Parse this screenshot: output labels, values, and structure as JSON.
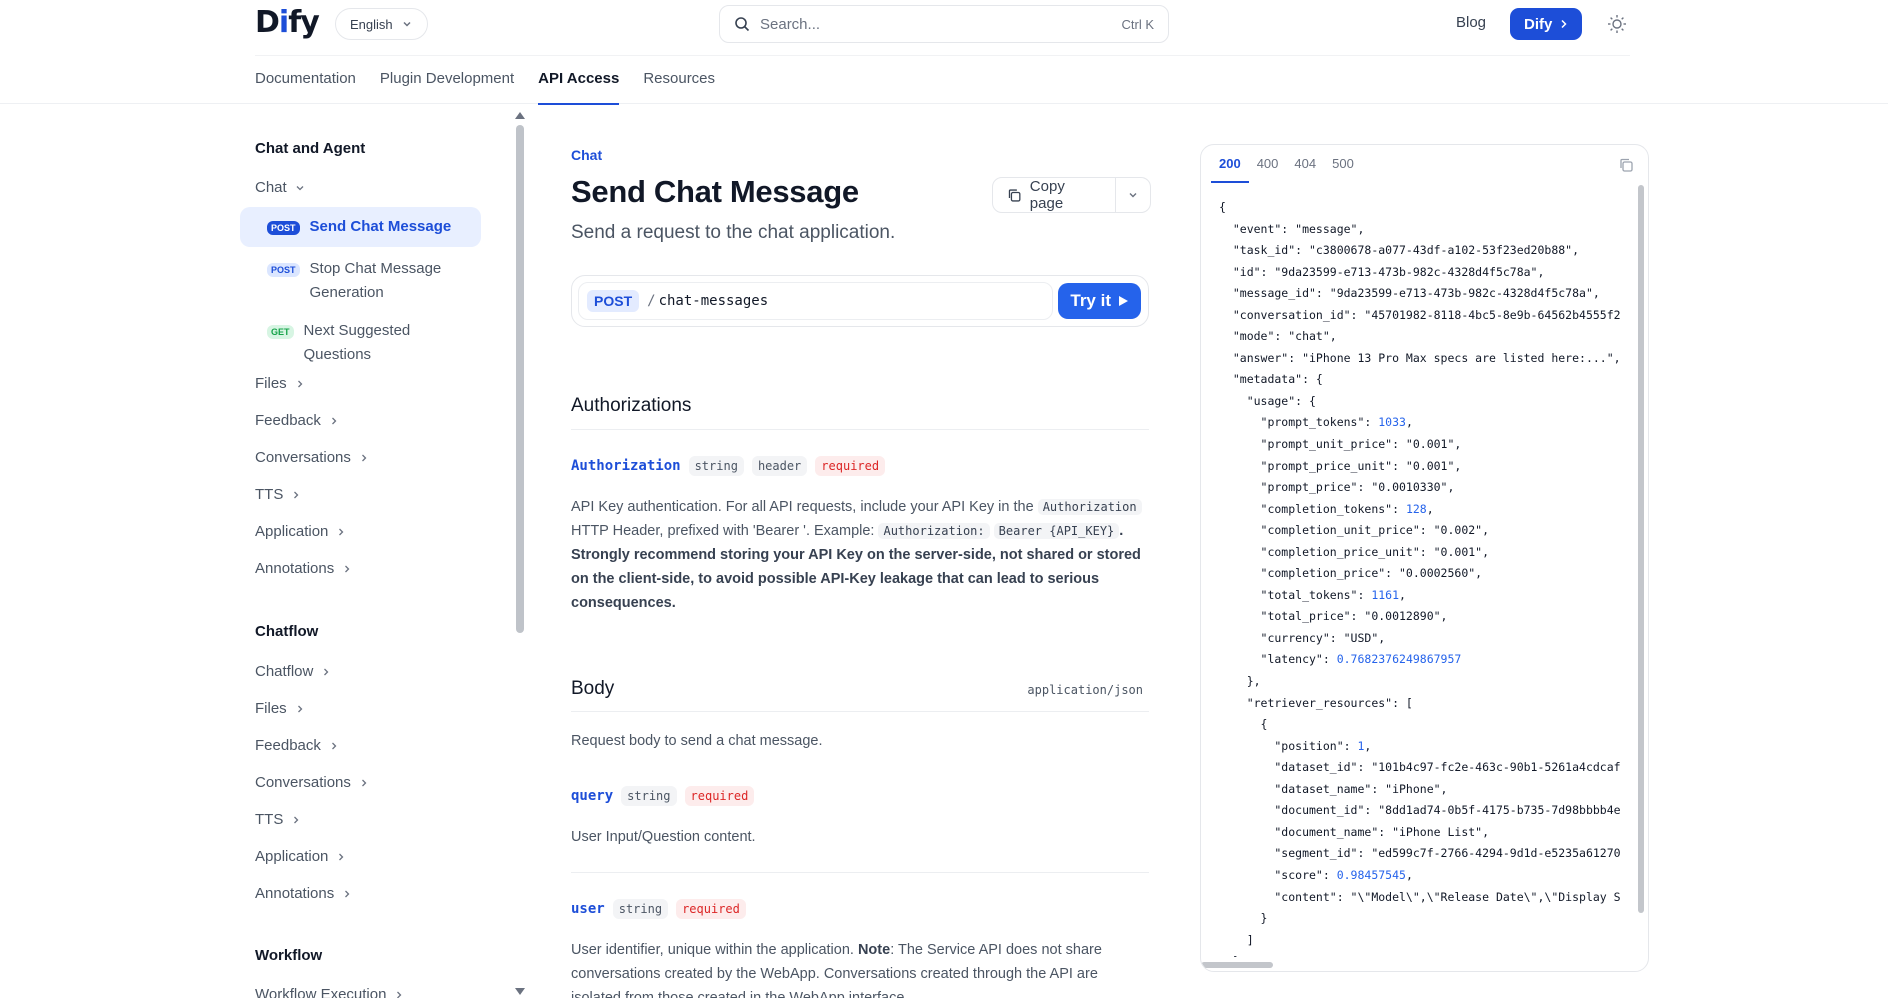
{
  "header": {
    "logo": "Dify",
    "language": "English",
    "search_placeholder": "Search...",
    "search_shortcut": "Ctrl K",
    "blog": "Blog",
    "cta": "Dify"
  },
  "nav_tabs": [
    "Documentation",
    "Plugin Development",
    "API Access",
    "Resources"
  ],
  "sidebar": {
    "section_chat_agent": "Chat and Agent",
    "chat_group": "Chat",
    "chat_items": [
      {
        "method": "POST",
        "label": "Send Chat Message"
      },
      {
        "method": "POST",
        "label": "Stop Chat Message Generation"
      },
      {
        "method": "GET",
        "label": "Next Suggested Questions"
      }
    ],
    "chat_agent_groups": [
      "Files",
      "Feedback",
      "Conversations",
      "TTS",
      "Application",
      "Annotations"
    ],
    "section_chatflow": "Chatflow",
    "chatflow_groups": [
      "Chatflow",
      "Files",
      "Feedback",
      "Conversations",
      "TTS",
      "Application",
      "Annotations"
    ],
    "section_workflow": "Workflow",
    "workflow_groups": [
      "Workflow Execution"
    ]
  },
  "main": {
    "breadcrumb": "Chat",
    "title": "Send Chat Message",
    "description": "Send a request to the chat application.",
    "copy_page": "Copy page",
    "method": "POST",
    "path": "chat-messages",
    "try_it": "Try it",
    "auth_heading": "Authorizations",
    "auth_param": {
      "name": "Authorization",
      "type": "string",
      "location": "header",
      "required": "required"
    },
    "auth_text_1": "API Key authentication. For all API requests, include your API Key in the",
    "auth_code_1": "Authorization",
    "auth_text_2": "HTTP Header, prefixed with 'Bearer '. Example:",
    "auth_code_2": "Authorization:",
    "auth_code_3": "Bearer {API_KEY}",
    "auth_text_3": ". Strongly recommend storing your API Key on the server-side, not shared or stored on the client-side, to avoid possible API-Key leakage that can lead to serious consequences.",
    "body_heading": "Body",
    "body_mime": "application/json",
    "body_desc": "Request body to send a chat message.",
    "query_param": {
      "name": "query",
      "type": "string",
      "required": "required"
    },
    "query_desc": "User Input/Question content.",
    "user_param": {
      "name": "user",
      "type": "string",
      "required": "required"
    },
    "user_desc_1": "User identifier, unique within the application.",
    "user_desc_note": "Note",
    "user_desc_2": ": The Service API does not share conversations created by the WebApp. Conversations created through the API are isolated from those created in the WebApp interface."
  },
  "response": {
    "tabs": [
      "200",
      "400",
      "404",
      "500"
    ],
    "active_tab": "200",
    "json_lines": [
      "{",
      "  \"event\": \"message\",",
      "  \"task_id\": \"c3800678-a077-43df-a102-53f23ed20b88\",",
      "  \"id\": \"9da23599-e713-473b-982c-4328d4f5c78a\",",
      "  \"message_id\": \"9da23599-e713-473b-982c-4328d4f5c78a\",",
      "  \"conversation_id\": \"45701982-8118-4bc5-8e9b-64562b4555f2",
      "  \"mode\": \"chat\",",
      "  \"answer\": \"iPhone 13 Pro Max specs are listed here:...\",",
      "  \"metadata\": {",
      "    \"usage\": {",
      "      \"prompt_tokens\": 1033,",
      "      \"prompt_unit_price\": \"0.001\",",
      "      \"prompt_price_unit\": \"0.001\",",
      "      \"prompt_price\": \"0.0010330\",",
      "      \"completion_tokens\": 128,",
      "      \"completion_unit_price\": \"0.002\",",
      "      \"completion_price_unit\": \"0.001\",",
      "      \"completion_price\": \"0.0002560\",",
      "      \"total_tokens\": 1161,",
      "      \"total_price\": \"0.0012890\",",
      "      \"currency\": \"USD\",",
      "      \"latency\": 0.7682376249867957",
      "    },",
      "    \"retriever_resources\": [",
      "      {",
      "        \"position\": 1,",
      "        \"dataset_id\": \"101b4c97-fc2e-463c-90b1-5261a4cdcaf",
      "        \"dataset_name\": \"iPhone\",",
      "        \"document_id\": \"8dd1ad74-0b5f-4175-b735-7d98bbbb4e",
      "        \"document_name\": \"iPhone List\",",
      "        \"segment_id\": \"ed599c7f-2766-4294-9d1d-e5235a61270",
      "        \"score\": 0.98457545,",
      "        \"content\": \"\\\"Model\\\",\\\"Release Date\\\",\\\"Display S",
      "      }",
      "    ]",
      "  }"
    ]
  },
  "colors": {
    "accent": "#1d4ed8",
    "required": "#dc2626",
    "get": "#16a34a"
  }
}
